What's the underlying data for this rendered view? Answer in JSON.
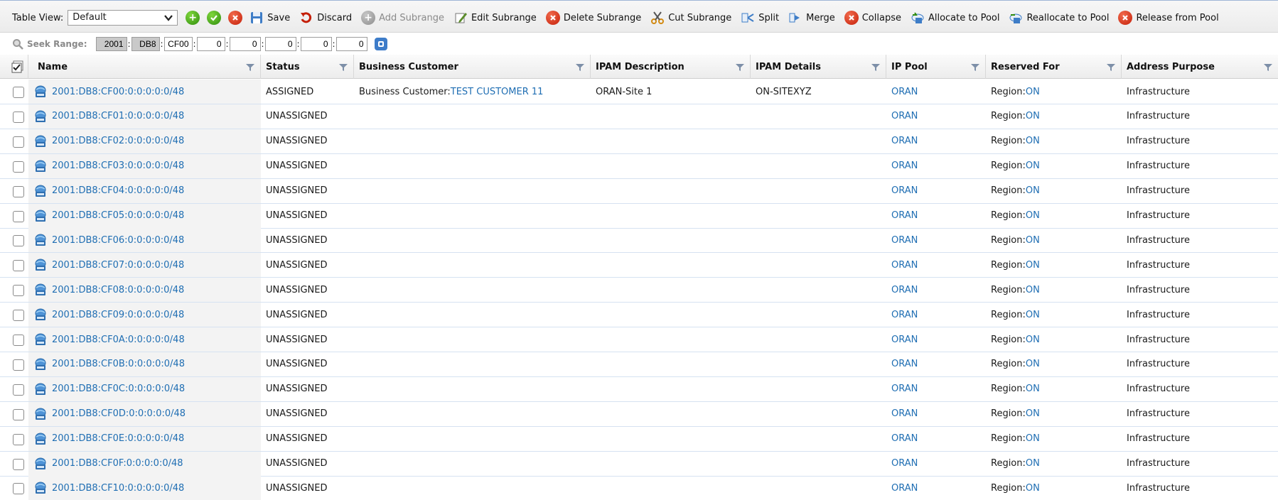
{
  "toolbar": {
    "table_view_label": "Table View:",
    "table_view_value": "Default",
    "buttons": {
      "save": "Save",
      "discard": "Discard",
      "add_subrange": "Add Subrange",
      "edit_subrange": "Edit Subrange",
      "delete_subrange": "Delete Subrange",
      "cut_subrange": "Cut Subrange",
      "split": "Split",
      "merge": "Merge",
      "collapse": "Collapse",
      "allocate_to_pool": "Allocate to Pool",
      "reallocate_to_pool": "Reallocate to Pool",
      "release_from_pool": "Release from Pool"
    },
    "seek": {
      "label": "Seek Range:",
      "segments": [
        "2001",
        "DB8",
        "CF00",
        "0",
        "0",
        "0",
        "0",
        "0"
      ]
    }
  },
  "columns": [
    "Name",
    "Status",
    "Business Customer",
    "IPAM Description",
    "IPAM Details",
    "IP Pool",
    "Reserved For",
    "Address Purpose"
  ],
  "rows": [
    {
      "name": "2001:DB8:CF00:0:0:0:0:0/48",
      "status": "ASSIGNED",
      "bc_prefix": "Business Customer: ",
      "bc_link": "TEST CUSTOMER 11",
      "desc": "ORAN-Site 1",
      "details": "ON-SITEXYZ",
      "pool": "ORAN",
      "reserved_prefix": "Region: ",
      "reserved_link": "ON",
      "purpose": "Infrastructure"
    },
    {
      "name": "2001:DB8:CF01:0:0:0:0:0/48",
      "status": "UNASSIGNED",
      "bc_prefix": "",
      "bc_link": "",
      "desc": "",
      "details": "",
      "pool": "ORAN",
      "reserved_prefix": "Region: ",
      "reserved_link": "ON",
      "purpose": "Infrastructure"
    },
    {
      "name": "2001:DB8:CF02:0:0:0:0:0/48",
      "status": "UNASSIGNED",
      "bc_prefix": "",
      "bc_link": "",
      "desc": "",
      "details": "",
      "pool": "ORAN",
      "reserved_prefix": "Region: ",
      "reserved_link": "ON",
      "purpose": "Infrastructure"
    },
    {
      "name": "2001:DB8:CF03:0:0:0:0:0/48",
      "status": "UNASSIGNED",
      "bc_prefix": "",
      "bc_link": "",
      "desc": "",
      "details": "",
      "pool": "ORAN",
      "reserved_prefix": "Region: ",
      "reserved_link": "ON",
      "purpose": "Infrastructure"
    },
    {
      "name": "2001:DB8:CF04:0:0:0:0:0/48",
      "status": "UNASSIGNED",
      "bc_prefix": "",
      "bc_link": "",
      "desc": "",
      "details": "",
      "pool": "ORAN",
      "reserved_prefix": "Region: ",
      "reserved_link": "ON",
      "purpose": "Infrastructure"
    },
    {
      "name": "2001:DB8:CF05:0:0:0:0:0/48",
      "status": "UNASSIGNED",
      "bc_prefix": "",
      "bc_link": "",
      "desc": "",
      "details": "",
      "pool": "ORAN",
      "reserved_prefix": "Region: ",
      "reserved_link": "ON",
      "purpose": "Infrastructure"
    },
    {
      "name": "2001:DB8:CF06:0:0:0:0:0/48",
      "status": "UNASSIGNED",
      "bc_prefix": "",
      "bc_link": "",
      "desc": "",
      "details": "",
      "pool": "ORAN",
      "reserved_prefix": "Region: ",
      "reserved_link": "ON",
      "purpose": "Infrastructure"
    },
    {
      "name": "2001:DB8:CF07:0:0:0:0:0/48",
      "status": "UNASSIGNED",
      "bc_prefix": "",
      "bc_link": "",
      "desc": "",
      "details": "",
      "pool": "ORAN",
      "reserved_prefix": "Region: ",
      "reserved_link": "ON",
      "purpose": "Infrastructure"
    },
    {
      "name": "2001:DB8:CF08:0:0:0:0:0/48",
      "status": "UNASSIGNED",
      "bc_prefix": "",
      "bc_link": "",
      "desc": "",
      "details": "",
      "pool": "ORAN",
      "reserved_prefix": "Region: ",
      "reserved_link": "ON",
      "purpose": "Infrastructure"
    },
    {
      "name": "2001:DB8:CF09:0:0:0:0:0/48",
      "status": "UNASSIGNED",
      "bc_prefix": "",
      "bc_link": "",
      "desc": "",
      "details": "",
      "pool": "ORAN",
      "reserved_prefix": "Region: ",
      "reserved_link": "ON",
      "purpose": "Infrastructure"
    },
    {
      "name": "2001:DB8:CF0A:0:0:0:0:0/48",
      "status": "UNASSIGNED",
      "bc_prefix": "",
      "bc_link": "",
      "desc": "",
      "details": "",
      "pool": "ORAN",
      "reserved_prefix": "Region: ",
      "reserved_link": "ON",
      "purpose": "Infrastructure"
    },
    {
      "name": "2001:DB8:CF0B:0:0:0:0:0/48",
      "status": "UNASSIGNED",
      "bc_prefix": "",
      "bc_link": "",
      "desc": "",
      "details": "",
      "pool": "ORAN",
      "reserved_prefix": "Region: ",
      "reserved_link": "ON",
      "purpose": "Infrastructure"
    },
    {
      "name": "2001:DB8:CF0C:0:0:0:0:0/48",
      "status": "UNASSIGNED",
      "bc_prefix": "",
      "bc_link": "",
      "desc": "",
      "details": "",
      "pool": "ORAN",
      "reserved_prefix": "Region: ",
      "reserved_link": "ON",
      "purpose": "Infrastructure"
    },
    {
      "name": "2001:DB8:CF0D:0:0:0:0:0/48",
      "status": "UNASSIGNED",
      "bc_prefix": "",
      "bc_link": "",
      "desc": "",
      "details": "",
      "pool": "ORAN",
      "reserved_prefix": "Region: ",
      "reserved_link": "ON",
      "purpose": "Infrastructure"
    },
    {
      "name": "2001:DB8:CF0E:0:0:0:0:0/48",
      "status": "UNASSIGNED",
      "bc_prefix": "",
      "bc_link": "",
      "desc": "",
      "details": "",
      "pool": "ORAN",
      "reserved_prefix": "Region: ",
      "reserved_link": "ON",
      "purpose": "Infrastructure"
    },
    {
      "name": "2001:DB8:CF0F:0:0:0:0:0/48",
      "status": "UNASSIGNED",
      "bc_prefix": "",
      "bc_link": "",
      "desc": "",
      "details": "",
      "pool": "ORAN",
      "reserved_prefix": "Region: ",
      "reserved_link": "ON",
      "purpose": "Infrastructure"
    },
    {
      "name": "2001:DB8:CF10:0:0:0:0:0/48",
      "status": "UNASSIGNED",
      "bc_prefix": "",
      "bc_link": "",
      "desc": "",
      "details": "",
      "pool": "ORAN",
      "reserved_prefix": "Region: ",
      "reserved_link": "ON",
      "purpose": "Infrastructure"
    }
  ],
  "icons": {
    "row_icon": "network-range-icon",
    "save": "floppy-disk-icon",
    "discard": "undo-icon",
    "cut": "scissors-icon"
  },
  "colors": {
    "link": "#1f6eb3",
    "green": "#2f8d0d",
    "red": "#c5200a",
    "row_border": "#d6e2f1"
  }
}
